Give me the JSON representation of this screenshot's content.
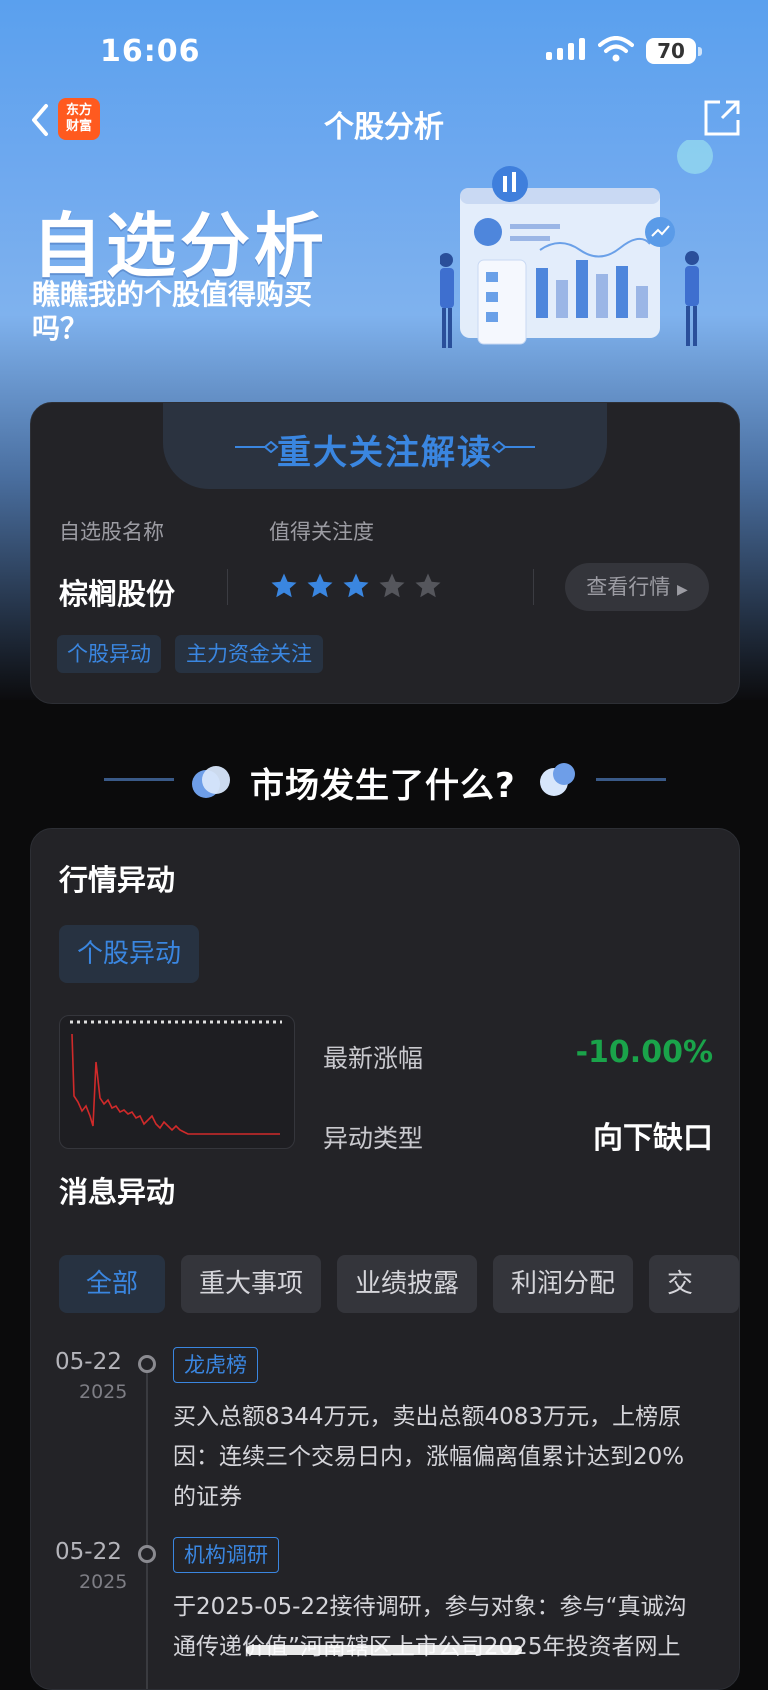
{
  "status": {
    "time": "16:06",
    "battery": "70"
  },
  "nav": {
    "title": "个股分析",
    "logo_line1": "东方",
    "logo_line2": "财富"
  },
  "hero": {
    "title": "自选分析",
    "subtitle": "瞧瞧我的个股值得购买吗？"
  },
  "focus_card": {
    "header": "重大关注解读",
    "col_name_label": "自选股名称",
    "col_attention_label": "值得关注度",
    "stock_name": "棕榈股份",
    "attention_stars": 3,
    "attention_max": 5,
    "view_button": "查看行情",
    "tags": [
      "个股异动",
      "主力资金关注"
    ]
  },
  "section_title": "市场发生了什么?",
  "market": {
    "title": "行情异动",
    "chip": "个股异动",
    "latest_change_label": "最新涨幅",
    "latest_change_value": "-10.00%",
    "anomaly_type_label": "异动类型",
    "anomaly_type_value": "向下缺口"
  },
  "news": {
    "title": "消息异动",
    "filters": [
      "全部",
      "重大事项",
      "业绩披露",
      "利润分配",
      "交"
    ],
    "items": [
      {
        "date": "05-22",
        "year": "2025",
        "tag": "龙虎榜",
        "body": "买入总额8344万元，卖出总额4083万元，上榜原因：连续三个交易日内，涨幅偏离值累计达到20%的证券"
      },
      {
        "date": "05-22",
        "year": "2025",
        "tag": "机构调研",
        "body": "于2025-05-22接待调研，参与对象：参与“真诚沟通传递价值”河南辖区上市公司2025年投资者网上"
      }
    ]
  },
  "colors": {
    "accent": "#3a86e0",
    "down_green": "#1aa34a",
    "card_bg": "#232327"
  }
}
